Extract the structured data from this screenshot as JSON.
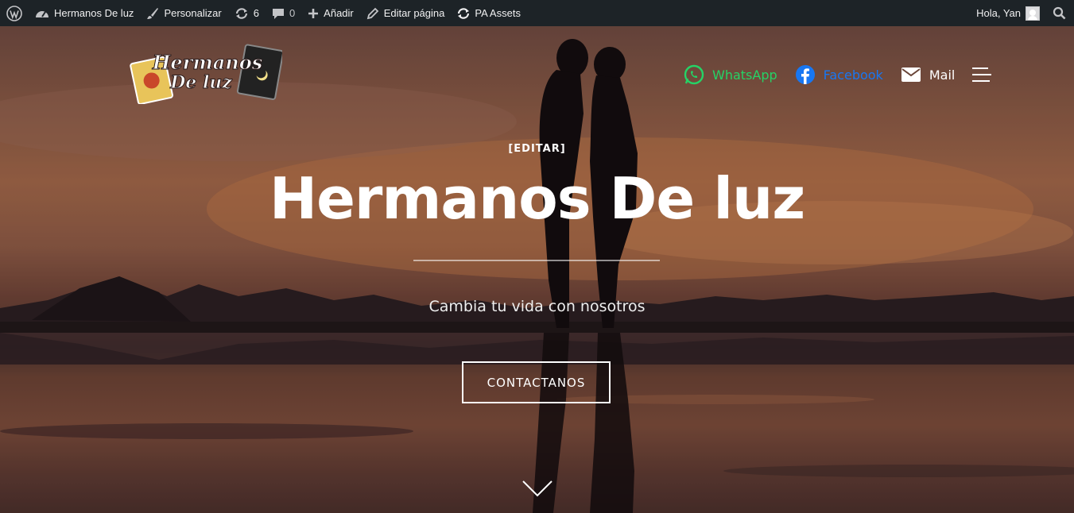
{
  "adminbar": {
    "site_name": "Hermanos De luz",
    "customize": "Personalizar",
    "updates_count": "6",
    "comments_count": "0",
    "add_new": "Añadir",
    "edit_page": "Editar página",
    "pa_assets": "PA Assets",
    "greeting": "Hola, Yan"
  },
  "logo": {
    "line1": "Hermanos",
    "line2": "De luz"
  },
  "nav": {
    "whatsapp": "WhatsApp",
    "facebook": "Facebook",
    "mail": "Mail"
  },
  "hero": {
    "edit_link": "[EDITAR]",
    "title": "Hermanos De luz",
    "subtitle": "Cambia tu vida con nosotros",
    "cta": "CONTACTANOS"
  },
  "colors": {
    "adminbar_bg": "#1d2327",
    "whatsapp": "#25d366",
    "facebook": "#1877f2"
  }
}
